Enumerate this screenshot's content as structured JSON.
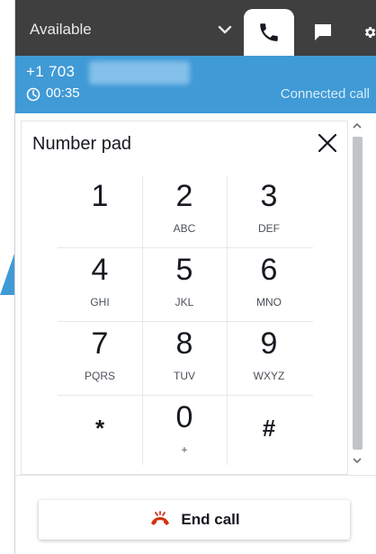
{
  "header": {
    "status_label": "Available",
    "tabs": [
      {
        "icon": "phone-icon"
      },
      {
        "icon": "chat-icon"
      },
      {
        "icon": "gear-icon"
      }
    ]
  },
  "call": {
    "number": "+1 703",
    "timer": "00:35",
    "status": "Connected call"
  },
  "number_pad": {
    "title": "Number pad",
    "keys": [
      {
        "digit": "1",
        "letters": ""
      },
      {
        "digit": "2",
        "letters": "ABC"
      },
      {
        "digit": "3",
        "letters": "DEF"
      },
      {
        "digit": "4",
        "letters": "GHI"
      },
      {
        "digit": "5",
        "letters": "JKL"
      },
      {
        "digit": "6",
        "letters": "MNO"
      },
      {
        "digit": "7",
        "letters": "PQRS"
      },
      {
        "digit": "8",
        "letters": "TUV"
      },
      {
        "digit": "9",
        "letters": "WXYZ"
      },
      {
        "digit": "*",
        "letters": ""
      },
      {
        "digit": "0",
        "letters": "+"
      },
      {
        "digit": "#",
        "letters": ""
      }
    ]
  },
  "end_call": {
    "label": "End call"
  },
  "colors": {
    "topbar": "#3f3f3f",
    "banner": "#3f9ad6",
    "end_call_icon": "#d13212"
  }
}
